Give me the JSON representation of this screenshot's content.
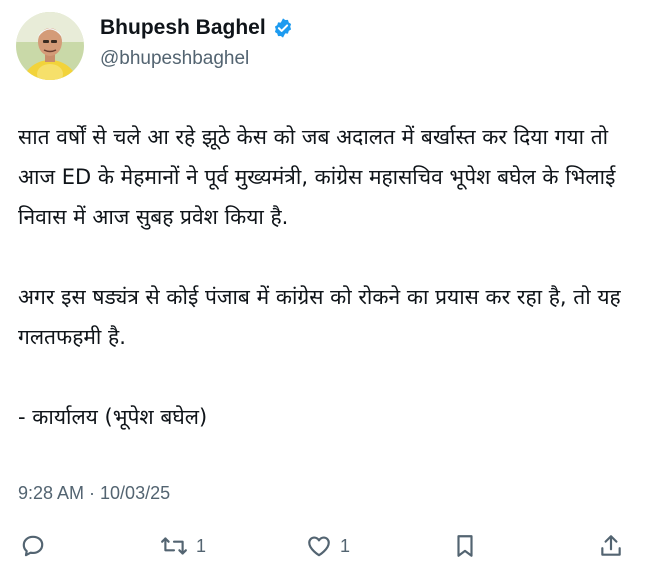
{
  "tweet": {
    "author": {
      "name": "Bhupesh Baghel",
      "handle": "@bhupeshbaghel",
      "verified": true,
      "verified_color": "#1d9bf0"
    },
    "body": {
      "paragraph_1": "सात वर्षों से चले आ रहे झूठे केस को जब अदालत में बर्खास्त कर दिया गया तो आज ED के मेहमानों ने पूर्व मुख्यमंत्री, कांग्रेस महासचिव भूपेश बघेल के भिलाई निवास में आज सुबह प्रवेश किया है.",
      "paragraph_2": "अगर इस षड्यंत्र से कोई पंजाब में कांग्रेस को रोकने का प्रयास कर रहा है, तो यह गलतफहमी है.",
      "paragraph_3": "- कार्यालय (भूपेश बघेल)"
    },
    "timestamp": "9:28 AM · 10/03/25",
    "actions": {
      "reply_icon": "reply-icon",
      "retweet_icon": "retweet-icon",
      "retweet_count": "1",
      "like_icon": "heart-icon",
      "like_count": "1",
      "bookmark_icon": "bookmark-icon",
      "share_icon": "share-icon"
    }
  }
}
